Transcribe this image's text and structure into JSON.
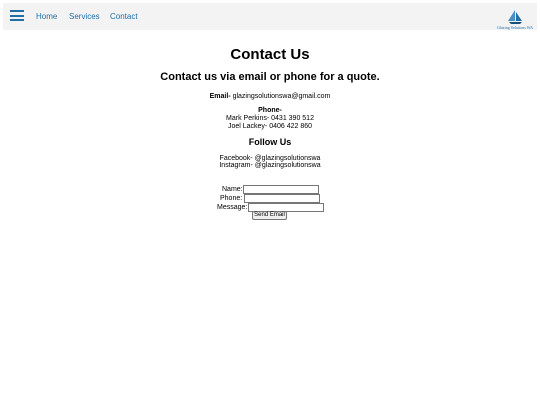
{
  "nav": {
    "links": [
      "Home",
      "Services",
      "Contact"
    ],
    "logo_text": "Glazing Solutions WA"
  },
  "main": {
    "title": "Contact Us",
    "subtitle": "Contact us via email or phone for a quote.",
    "email_label": "Email-",
    "email_value": "glazingsolutionswa@gmail.com",
    "phone_label": "Phone-",
    "phone_1": "Mark Perkins- 0431 390 512",
    "phone_2": "Joel Lackey- 0406 422 860",
    "follow_heading": "Follow Us",
    "facebook": "Facebook- @glazingsolutionswa",
    "instagram": "Instagram- @glazingsolutionswa"
  },
  "form": {
    "name_label": "Name:",
    "phone_label": "Phone:",
    "message_label": "Message:",
    "send_label": "Send Email"
  },
  "colors": {
    "nav_background": "#f3f3f3",
    "link": "#1f6fa8"
  }
}
